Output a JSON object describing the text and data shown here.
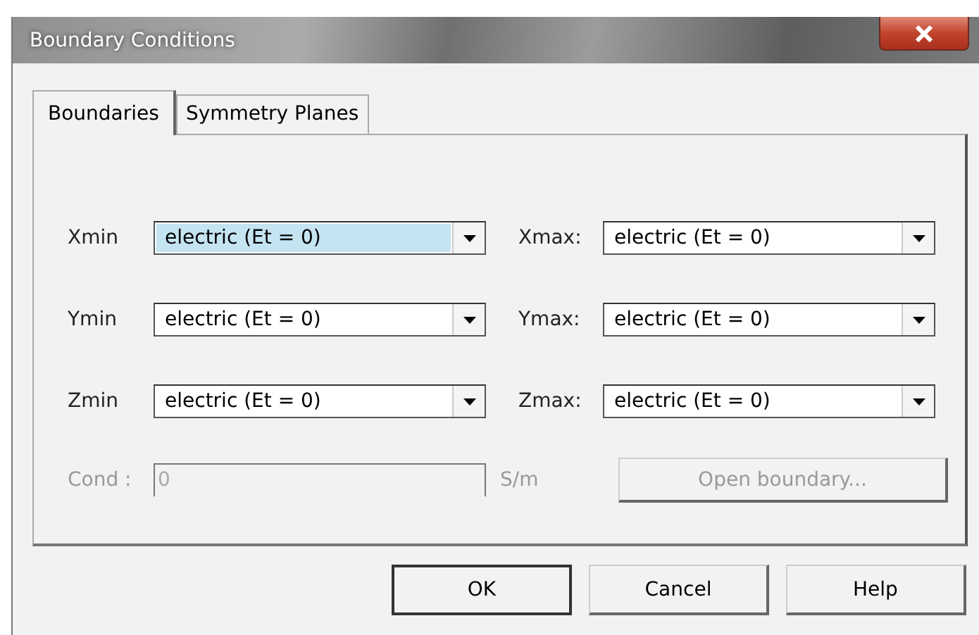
{
  "window": {
    "title": "Boundary Conditions"
  },
  "tabs": [
    {
      "label": "Boundaries",
      "selected": true
    },
    {
      "label": "Symmetry Planes",
      "selected": false
    }
  ],
  "boundaries": [
    {
      "label": "Xmin",
      "value": "electric (Et = 0)",
      "focused": true
    },
    {
      "label": "Xmax:",
      "value": "electric (Et = 0)",
      "focused": false
    },
    {
      "label": "Ymin",
      "value": "electric (Et = 0)",
      "focused": false
    },
    {
      "label": "Ymax:",
      "value": "electric (Et = 0)",
      "focused": false
    },
    {
      "label": "Zmin",
      "value": "electric (Et = 0)",
      "focused": false
    },
    {
      "label": "Zmax:",
      "value": "electric (Et = 0)",
      "focused": false
    }
  ],
  "conductivity": {
    "label": "Cond :",
    "value": "0",
    "unit": "S/m",
    "disabled": true
  },
  "open_boundary": {
    "label": "Open boundary...",
    "disabled": true
  },
  "buttons": [
    {
      "label": "OK",
      "default": true
    },
    {
      "label": "Cancel",
      "default": false
    },
    {
      "label": "Help",
      "default": false
    }
  ]
}
